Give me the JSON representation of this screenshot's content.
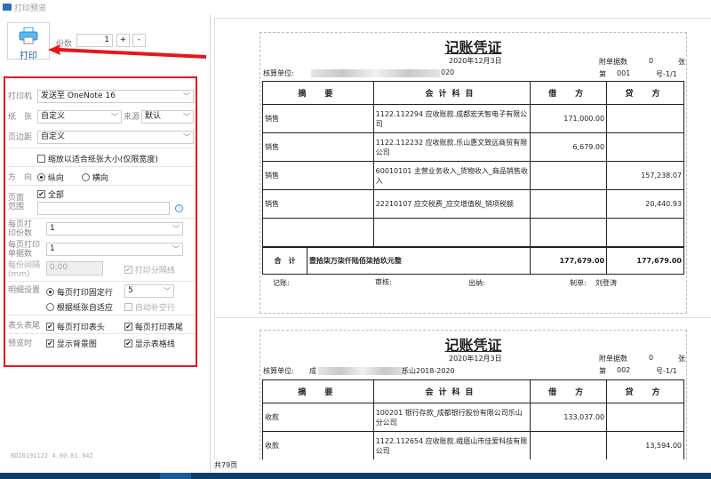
{
  "window": {
    "title": "打印预览"
  },
  "toolbar": {
    "print_label": "打印",
    "copies_label": "份数",
    "copies_value": "1",
    "plus": "+",
    "minus": "-"
  },
  "settings": {
    "printer_label": "打印机",
    "printer_value": "发送至 OneNote 16",
    "paper_label": "纸　张",
    "paper_value": "自定义",
    "source_label": "来源",
    "source_value": "默认",
    "margin_label": "页边距",
    "margin_value": "自定义",
    "fit_label": "缩放以适合纸张大小(仅限宽度)",
    "fit_checked": false,
    "orientation_label": "方　向",
    "portrait": "纵向",
    "landscape": "横向",
    "range_label": "页面范围",
    "range_all": "全部",
    "range_value": "",
    "copies_per_page_label": "每页打印份数",
    "copies_per_page": "1",
    "docs_per_page_label": "每页打印单据数",
    "docs_per_page": "1",
    "gap_label": "每份间隔(mm)",
    "gap_value": "0.00",
    "separator_label": "打印分隔线",
    "detail_label": "明细设置",
    "fixed_rows_label": "每页打印固定行",
    "fixed_rows": "5",
    "auto_fit_label": "根据纸张自适应",
    "fill_blank_label": "自动补空行",
    "headfoot_label": "表头表尾",
    "print_header": "每页打印表头",
    "print_footer": "每页打印表尾",
    "preview_label": "预览时",
    "show_bg": "显示背景图",
    "show_grid": "显示表格线"
  },
  "version": "BD20191122 4.00.01.042",
  "colors": {
    "highlight": "#e8161b",
    "accent": "#2060b0",
    "taskbar": "#0b3d68"
  },
  "vouchers": [
    {
      "title": "记账凭证",
      "date": "2020年12月3日",
      "attach_label": "附单据数",
      "attach": "0",
      "attach_unit": "张",
      "unit_label": "核算单位:",
      "unit_value": "020",
      "no_label": "第",
      "no": "001",
      "no_suffix": "号-1/1",
      "headers": [
        "摘　要",
        "会计科目",
        "借　方",
        "贷　方"
      ],
      "rows": [
        {
          "summary": "销售",
          "account": "1122.112294 应收账款.成都宏天智电子有限公司",
          "debit": "171,000.00",
          "credit": ""
        },
        {
          "summary": "销售",
          "account": "1122.112232 应收账款.乐山惠文致远商贸有限公司",
          "debit": "6,679.00",
          "credit": ""
        },
        {
          "summary": "销售",
          "account": "60010101 主营业务收入_货物收入_商品销售收入",
          "debit": "",
          "credit": "157,238.07"
        },
        {
          "summary": "销售",
          "account": "22210107 应交税费_应交增值税_销项税额",
          "debit": "",
          "credit": "20,440.93"
        }
      ],
      "total_label": "合　计",
      "total_words": "壹拾柒万柒仟陆佰柒拾玖元整",
      "total_debit": "177,679.00",
      "total_credit": "177,679.00",
      "bookkeeper_label": "记账:",
      "auditor_label": "审核:",
      "cashier_label": "出纳:",
      "maker_label": "制单:",
      "maker": "刘登涛"
    },
    {
      "title": "记账凭证",
      "date": "2020年12月3日",
      "attach_label": "附单据数",
      "attach": "0",
      "attach_unit": "张",
      "unit_label": "核算单位:",
      "unit_prefix": "成",
      "unit_value": "乐山2018-2020",
      "no_label": "第",
      "no": "002",
      "no_suffix": "号-1/1",
      "headers": [
        "摘　要",
        "会计科目",
        "借　方",
        "贷　方"
      ],
      "rows": [
        {
          "summary": "收款",
          "account": "100201 银行存款_成都银行股份有限公司乐山分公司",
          "debit": "133,037.00",
          "credit": ""
        },
        {
          "summary": "收款",
          "account": "1122.112654 应收账款.峨眉山市佳爱科技有限公司",
          "debit": "",
          "credit": "13,594.00"
        }
      ]
    }
  ],
  "status": {
    "pages": "共79页"
  }
}
